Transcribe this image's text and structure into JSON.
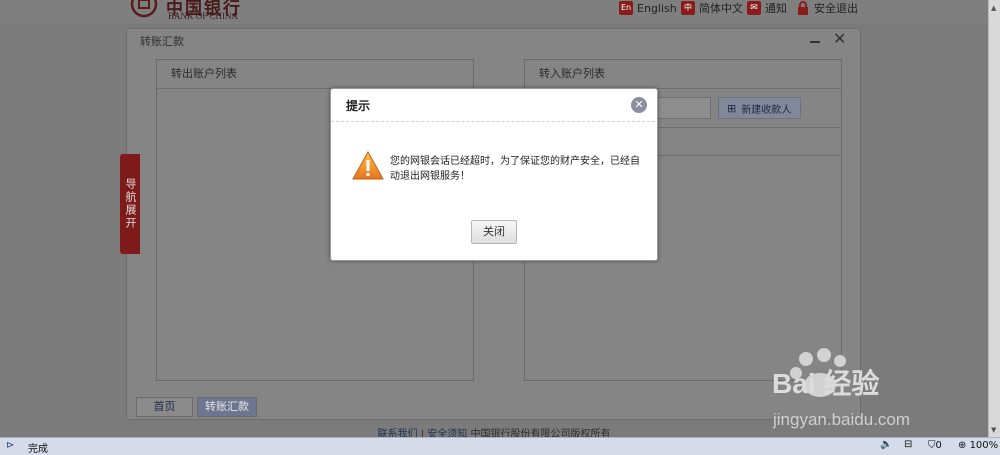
{
  "header": {
    "logo_cn": "中国银行",
    "logo_en": "BANK OF CHINA",
    "links": [
      {
        "icon": "en-icon",
        "badge": "En",
        "label": "English"
      },
      {
        "icon": "zh-icon",
        "badge": "中",
        "label": "简体中文"
      },
      {
        "icon": "mail-icon",
        "badge": "✉",
        "label": "通知"
      },
      {
        "icon": "lock-icon",
        "badge": "🔒",
        "label": "安全退出"
      }
    ]
  },
  "window": {
    "title": "转账汇款",
    "left_panel_title": "转出账户列表",
    "right_panel_title": "转入账户列表",
    "new_payee_label": "新建收款人"
  },
  "nav_tab": "导航展开",
  "tabs": [
    "首页",
    "转账汇款"
  ],
  "footer": {
    "contact": "联系我们",
    "separator": "|",
    "security": "安全须知",
    "copyright": "中国银行股份有限公司版权所有"
  },
  "dialog": {
    "title": "提示",
    "message": "您的网银会话已经超时，为了保证您的财产安全，已经自动退出网银服务！",
    "close_button": "关闭"
  },
  "watermark": {
    "brand": "Bai 经验",
    "url": "jingyan.baidu.com"
  },
  "statusbar": {
    "status": "完成",
    "shield_count": "0",
    "zoom": "100%"
  },
  "colors": {
    "brand_red": "#b3142a",
    "overlay": "#7b7b7b"
  }
}
